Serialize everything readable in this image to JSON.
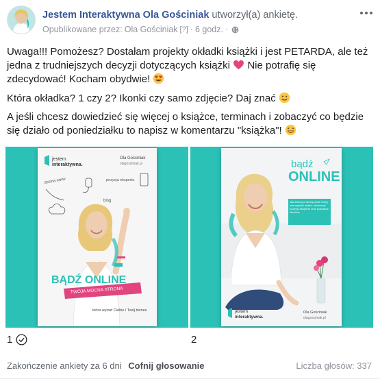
{
  "header": {
    "author": "Jestem Interaktywna Ola Gościniak",
    "action": "utworzył(a) ankietę.",
    "published_by_prefix": "Opublikowane przez:",
    "published_by": "Ola Gościniak",
    "help_mark": "[?]",
    "separator": "·",
    "time": "6 godz.",
    "privacy_icon": "globe-icon"
  },
  "body": {
    "p1_a": "Uwaga!!! Pomożesz? Dostałam projekty okładki książki i jest PETARDA, ale też jedna z trudniejszych decyzji dotyczących książki",
    "p1_b": "Nie potrafię się zdecydować! Kocham obydwie!",
    "p2": "Która okładka? 1 czy 2? Ikonki czy samo zdjęcie? Daj znać",
    "p3": "A jeśli chcesz dowiedzieć się więcej o książce, terminach i zobaczyć co będzie się działo od poniedziałku to napisz w komentarzu \"książka\"!",
    "emojis": [
      "heart-icon",
      "heart-eyes-icon",
      "smile-icon",
      "laugh-icon"
    ]
  },
  "poll": {
    "options": [
      {
        "label": "1",
        "selected": true,
        "cover": {
          "brand_line1": "jestem",
          "brand_line2": "interaktywna.",
          "author": "Ola Gościniak",
          "site": "olagosciniak.pl",
          "doodles": [
            "strona www",
            "pozycja eksperta",
            "blog"
          ],
          "title": "BĄDŹ ONLINE",
          "subtitle": "TWOJA MOCNA STRONA",
          "tagline": "która wyrazi Ciebie i Twój biznes"
        }
      },
      {
        "label": "2",
        "selected": false,
        "cover": {
          "title_small": "bądź",
          "title_big": "ONLINE",
          "blurb": "Jak stworzyć stronę www i blog, obs wyrazić siebie, zbudować pozycję eksperta oraz pozyskać klientów.",
          "brand_line1": "jestem",
          "brand_line2": "interaktywna.",
          "author": "Ola Gościniak",
          "site": "olagosciniak.pl"
        }
      }
    ]
  },
  "footer": {
    "ends": "Zakończenie ankiety za 6 dni",
    "undo": "Cofnij głosowanie",
    "votes": "Liczba głosów: 337"
  },
  "colors": {
    "teal": "#2cc1b6",
    "link": "#385898",
    "pink": "#e2447f",
    "text": "#1c1e21"
  }
}
